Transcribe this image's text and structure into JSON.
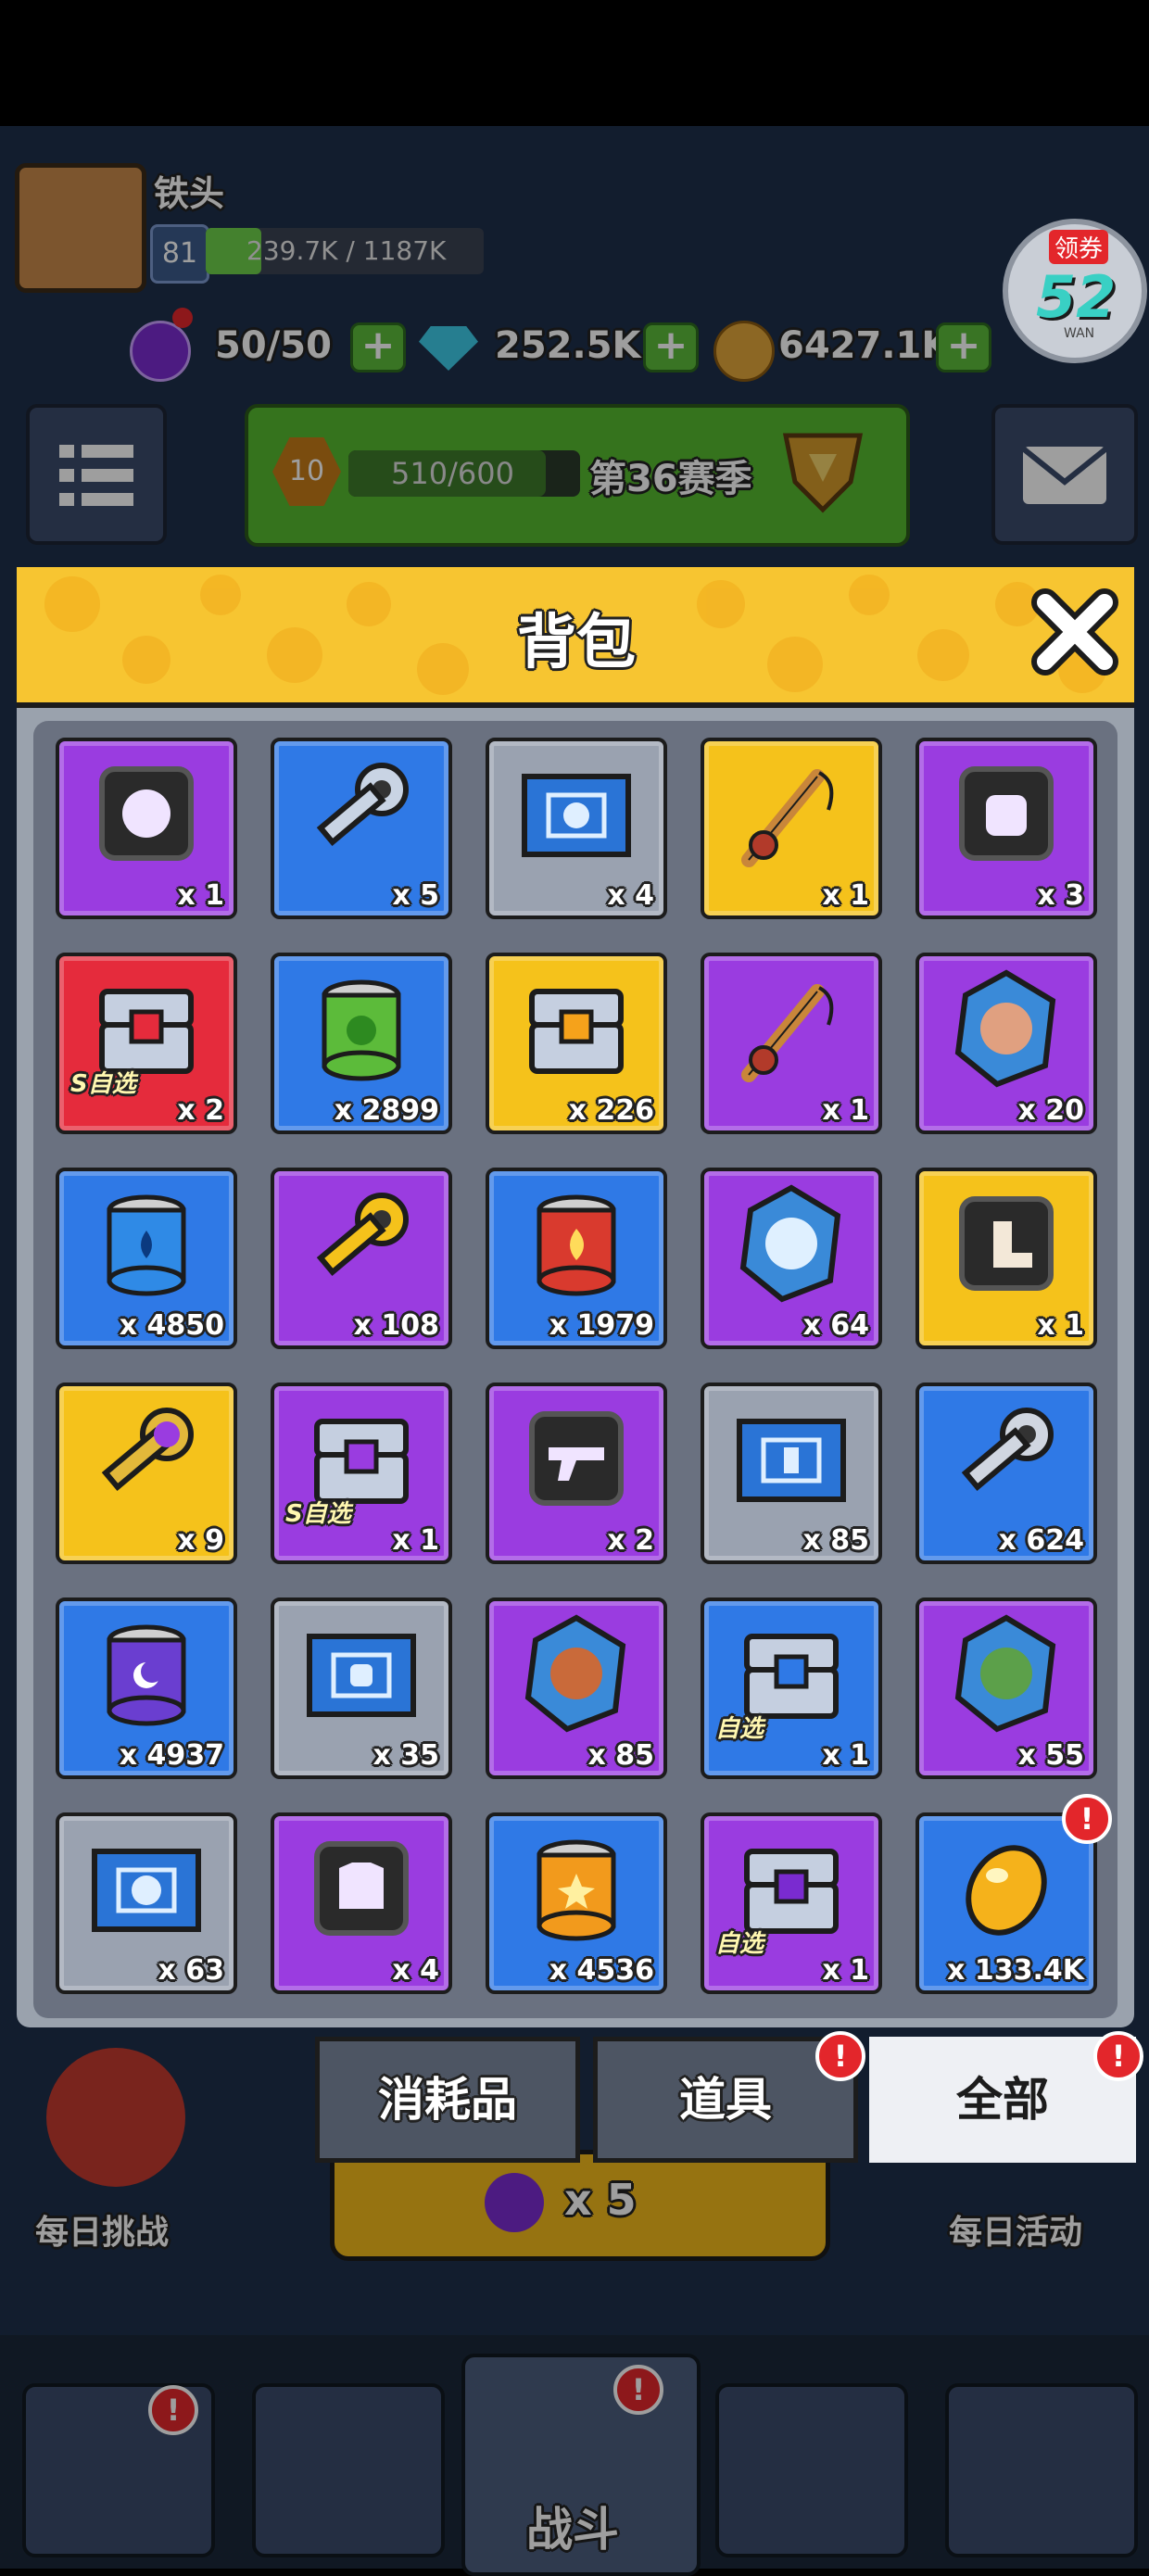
{
  "player": {
    "name": "铁头",
    "level": "81",
    "exp": "239.7K / 1187K"
  },
  "resources": {
    "energy": "50/50",
    "gems": "252.5K",
    "coins": "6427.1K"
  },
  "season": {
    "rank": "10",
    "progress": "510/600",
    "progress_fraction": 0.85,
    "label": "第36赛季"
  },
  "promo": {
    "tag": "领券",
    "number": "52",
    "sub": "WAN"
  },
  "bottom_bg": {
    "daily_challenge": "每日挑战",
    "daily_activity": "每日活动",
    "energy_cost": "x 5",
    "battle": "战斗"
  },
  "backpack": {
    "title": "背包",
    "items": [
      {
        "icon": "helmet-icon",
        "bg": "purple",
        "qty": "x 1",
        "tag": ""
      },
      {
        "icon": "silver-key-icon",
        "bg": "blue",
        "qty": "x 5",
        "tag": ""
      },
      {
        "icon": "blueprint-helmet-icon",
        "bg": "gray",
        "qty": "x 4",
        "tag": ""
      },
      {
        "icon": "fishing-rod-icon",
        "bg": "gold",
        "qty": "x 1",
        "tag": ""
      },
      {
        "icon": "backpack-icon",
        "bg": "purple",
        "qty": "x 3",
        "tag": ""
      },
      {
        "icon": "red-chest-icon",
        "bg": "red",
        "qty": "x 2",
        "tag": "S自选"
      },
      {
        "icon": "green-can-icon",
        "bg": "blue",
        "qty": "x 2899",
        "tag": ""
      },
      {
        "icon": "gold-chest-icon",
        "bg": "gold",
        "qty": "x 226",
        "tag": ""
      },
      {
        "icon": "fishing-rod-icon",
        "bg": "purple",
        "qty": "x 1",
        "tag": ""
      },
      {
        "icon": "hero-shard-icon",
        "bg": "purple",
        "qty": "x 20",
        "tag": ""
      },
      {
        "icon": "water-can-icon",
        "bg": "blue",
        "qty": "x 4850",
        "tag": ""
      },
      {
        "icon": "gold-key-icon",
        "bg": "purple",
        "qty": "x 108",
        "tag": ""
      },
      {
        "icon": "fire-can-icon",
        "bg": "blue",
        "qty": "x 1979",
        "tag": ""
      },
      {
        "icon": "ghost-shard-icon",
        "bg": "purple",
        "qty": "x 64",
        "tag": ""
      },
      {
        "icon": "boots-icon",
        "bg": "gold",
        "qty": "x 1",
        "tag": ""
      },
      {
        "icon": "purple-key-icon",
        "bg": "gold",
        "qty": "x 9",
        "tag": ""
      },
      {
        "icon": "purple-chest-icon",
        "bg": "purple",
        "qty": "x 1",
        "tag": "S自选"
      },
      {
        "icon": "gun-icon",
        "bg": "purple",
        "qty": "x 2",
        "tag": ""
      },
      {
        "icon": "blueprint-boots-icon",
        "bg": "gray",
        "qty": "x 85",
        "tag": ""
      },
      {
        "icon": "ring-key-icon",
        "bg": "blue",
        "qty": "x 624",
        "tag": ""
      },
      {
        "icon": "moon-can-icon",
        "bg": "blue",
        "qty": "x 4937",
        "tag": ""
      },
      {
        "icon": "blueprint-backpack-icon",
        "bg": "gray",
        "qty": "x 35",
        "tag": ""
      },
      {
        "icon": "raccoon-shard-icon",
        "bg": "purple",
        "qty": "x 85",
        "tag": ""
      },
      {
        "icon": "blue-chest-icon",
        "bg": "blue",
        "qty": "x 1",
        "tag": "自选"
      },
      {
        "icon": "ninja-shard-icon",
        "bg": "purple",
        "qty": "x 55",
        "tag": ""
      },
      {
        "icon": "blueprint-mask-icon",
        "bg": "gray",
        "qty": "x 63",
        "tag": ""
      },
      {
        "icon": "armor-icon",
        "bg": "purple",
        "qty": "x 4",
        "tag": ""
      },
      {
        "icon": "star-can-icon",
        "bg": "blue",
        "qty": "x 4536",
        "tag": ""
      },
      {
        "icon": "purple-gem-chest-icon",
        "bg": "purple",
        "qty": "x 1",
        "tag": "自选"
      },
      {
        "icon": "gold-egg-icon",
        "bg": "blue",
        "qty": "x 133.4K",
        "tag": "",
        "alert": "!"
      }
    ],
    "tabs": [
      {
        "label": "消耗品",
        "alert": "",
        "active": false
      },
      {
        "label": "道具",
        "alert": "!",
        "active": false
      },
      {
        "label": "全部",
        "alert": "!",
        "active": true
      }
    ]
  },
  "colors": {
    "purple": "#9a3ce0",
    "blue": "#2f79e6",
    "gray": "#9aa2b0",
    "gold": "#f5c21b",
    "red": "#e52b3c",
    "header": "#f7c531"
  }
}
